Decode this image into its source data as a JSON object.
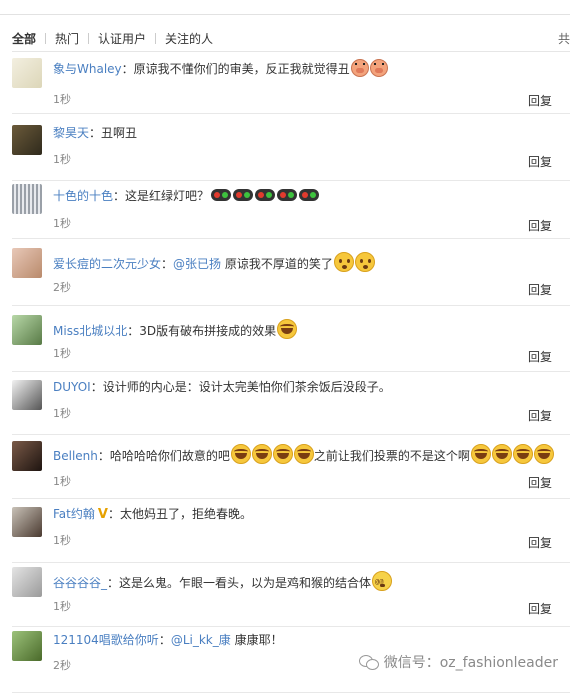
{
  "tabs": {
    "all": "全部",
    "hot": "热门",
    "verified": "认证用户",
    "following": "关注的人",
    "more": "共"
  },
  "reply_label": "回复",
  "comments": [
    {
      "user": "象与Whaley",
      "sep": "：",
      "mention": "",
      "text": "原谅我不懂你们的审美，反正我就觉得丑",
      "text2": "",
      "time": "1秒",
      "emojis": [
        "pig-face-icon",
        "pig-face-icon"
      ],
      "emojis2": []
    },
    {
      "user": "黎昊天",
      "sep": "：",
      "mention": "",
      "text": "丑啊丑",
      "text2": "",
      "time": "1秒",
      "emojis": [],
      "emojis2": []
    },
    {
      "user": "十色的十色",
      "sep": "：",
      "mention": "",
      "text": "这是红绿灯吧？",
      "text2": "",
      "time": "1秒",
      "emojis": [
        "traffic-light-icon",
        "traffic-light-icon",
        "traffic-light-icon",
        "traffic-light-icon",
        "traffic-light-icon"
      ],
      "emojis2": []
    },
    {
      "user": "爱长痘的二次元少女",
      "sep": "：",
      "mention": "@张已扬",
      "text": "原谅我不厚道的笑了",
      "text2": "",
      "time": "2秒",
      "emojis": [
        "shy-face-icon",
        "shy-face-icon"
      ],
      "emojis2": []
    },
    {
      "user": "Miss北城以北",
      "sep": "：",
      "mention": "",
      "text": "3D版有破布拼接成的效果",
      "text2": "",
      "time": "1秒",
      "emojis": [
        "laugh-face-icon"
      ],
      "emojis2": []
    },
    {
      "user": "DUYOI",
      "sep": "：",
      "mention": "",
      "text": "设计师的内心是：设计太完美怕你们茶余饭后没段子。",
      "text2": "",
      "time": "1秒",
      "emojis": [],
      "emojis2": []
    },
    {
      "user": "Bellenh",
      "sep": "：",
      "mention": "",
      "text": "哈哈哈哈你们故意的吧",
      "text2": "之前让我们投票的不是这个啊",
      "time": "1秒",
      "emojis": [
        "laugh-face-icon",
        "laugh-face-icon",
        "laugh-face-icon",
        "laugh-face-icon"
      ],
      "emojis2": [
        "laugh-face-icon",
        "laugh-face-icon",
        "laugh-face-icon",
        "laugh-face-icon"
      ]
    },
    {
      "user": "Fat约翰",
      "badge": "V",
      "sep": "：",
      "mention": "",
      "text": "太他妈丑了，拒绝春晚。",
      "text2": "",
      "time": "1秒",
      "emojis": [],
      "emojis2": []
    },
    {
      "user": "谷谷谷谷_",
      "sep": "：",
      "mention": "",
      "text": "这是么鬼。乍眼一看头，以为是鸡和猴的结合体",
      "text2": "",
      "time": "1秒",
      "emojis": [
        "dizzy-face-icon"
      ],
      "emojis2": []
    },
    {
      "user": "121104唱歌给你听",
      "sep": "：",
      "mention": "@Li_kk_康",
      "text": "康康耶！",
      "text2": "",
      "time": "2秒",
      "emojis": [],
      "emojis2": []
    }
  ],
  "watermark": "微信号：oz_fashionleader",
  "colors": {
    "link": "#4a7fc1",
    "text": "#333333",
    "time": "#888888"
  }
}
